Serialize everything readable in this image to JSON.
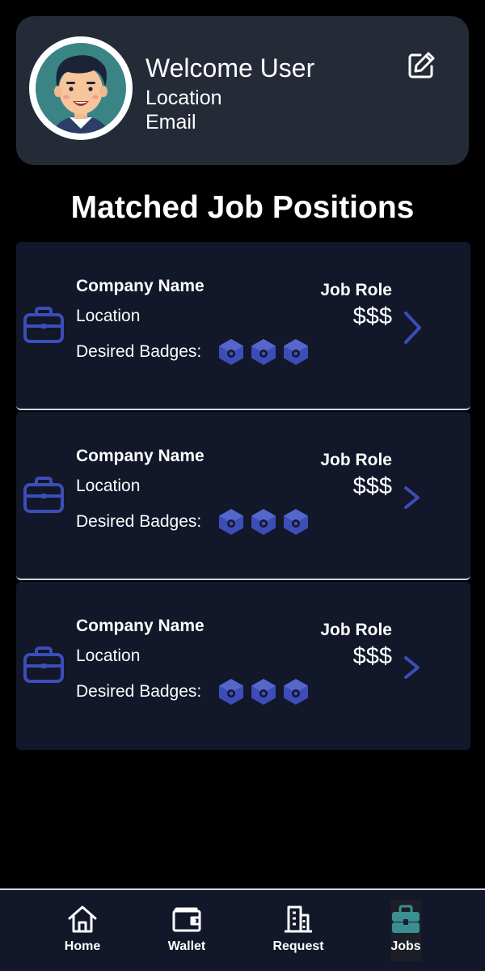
{
  "profile": {
    "welcome": "Welcome User",
    "location": "Location",
    "email": "Email"
  },
  "section_title": "Matched Job Positions",
  "jobs": [
    {
      "company": "Company Name",
      "location": "Location",
      "badges_label": "Desired Badges:",
      "role": "Job Role",
      "salary": "$$$"
    },
    {
      "company": "Company Name",
      "location": "Location",
      "badges_label": "Desired Badges:",
      "role": "Job Role",
      "salary": "$$$"
    },
    {
      "company": "Company Name",
      "location": "Location",
      "badges_label": "Desired Badges:",
      "role": "Job Role",
      "salary": "$$$"
    }
  ],
  "nav": {
    "items": [
      {
        "label": "Home",
        "icon": "home-icon"
      },
      {
        "label": "Wallet",
        "icon": "wallet-icon"
      },
      {
        "label": "Request",
        "icon": "building-icon"
      },
      {
        "label": "Jobs",
        "icon": "briefcase-icon",
        "active": true
      }
    ]
  },
  "colors": {
    "background": "#000000",
    "card": "#252a37",
    "job_card": "#121729",
    "accent_blue": "#3d4db7",
    "active_teal": "#3b8f93"
  }
}
